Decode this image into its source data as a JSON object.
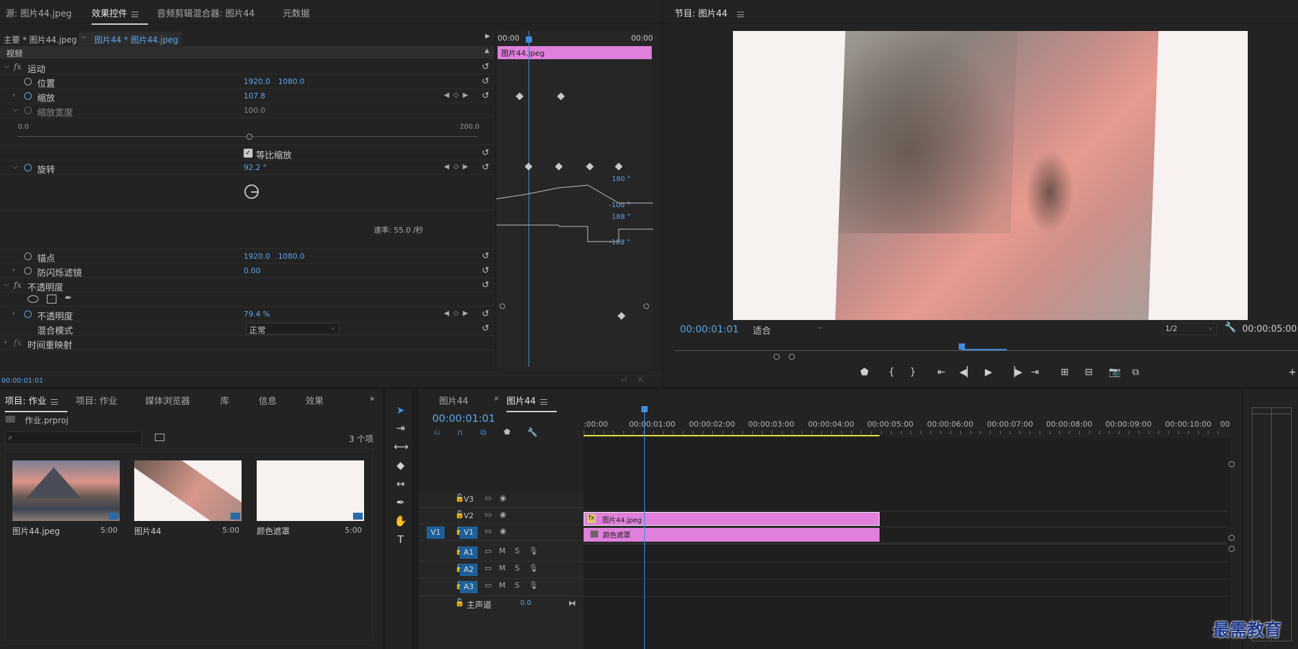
{
  "top_tabs": {
    "source": "源: 图片44.jpeg",
    "effect_controls": "效果控件",
    "audio_mixer": "音频剪辑混合器: 图片44",
    "metadata": "元数据",
    "program": "节目: 图片44"
  },
  "effect_controls": {
    "master_clip": "主要 * 图片44.jpeg",
    "active_clip": "图片44 * 图片44.jpeg",
    "section_video": "视频",
    "ruler_start": "00:00",
    "ruler_end": "00:00",
    "clip_bar_label": "图片44.jpeg",
    "motion": "运动",
    "position_label": "位置",
    "position_x": "1920.0",
    "position_y": "1080.0",
    "scale_label": "缩放",
    "scale_value": "107.8",
    "scale_width_label": "缩放宽度",
    "scale_width_value": "100.0",
    "slider_min": "0.0",
    "slider_max": "200.0",
    "uniform_scale": "等比缩放",
    "rotation_label": "旋转",
    "rotation_value": "92.2 °",
    "graph_top": "180 °",
    "graph_bottom": "-100 °",
    "velocity_top": "188 °",
    "velocity_bottom": "-188 °",
    "velocity_label": "速率: 55.0 /秒",
    "anchor_label": "锚点",
    "anchor_x": "1920.0",
    "anchor_y": "1080.0",
    "antiflicker_label": "防闪烁滤镜",
    "antiflicker_value": "0.00",
    "opacity_section": "不透明度",
    "opacity_label": "不透明度",
    "opacity_value": "79.4 %",
    "blend_label": "混合模式",
    "blend_value": "正常",
    "time_remap": "时间重映射",
    "current_time": "00:00:01:01"
  },
  "program_monitor": {
    "timecode": "00:00:01:01",
    "fit": "适合",
    "resolution": "1/2",
    "duration": "00:00:05:00"
  },
  "project_panel": {
    "tabs": [
      "项目: 作业",
      "项目: 作业",
      "媒体浏览器",
      "库",
      "信息",
      "效果"
    ],
    "project_file": "作业.prproj",
    "item_count": "3 个项",
    "items": [
      {
        "name": "图片44.jpeg",
        "duration": "5:00"
      },
      {
        "name": "图片44",
        "duration": "5:00"
      },
      {
        "name": "颜色遮罩",
        "duration": "5:00"
      }
    ]
  },
  "timeline": {
    "tab_inactive": "图片44",
    "tab_active": "图片44",
    "timecode": "00:00:01:01",
    "ruler": [
      ":00:00",
      "00:00:01:00",
      "00:00:02:00",
      "00:00:03:00",
      "00:00:04:00",
      "00:00:05:00",
      "00:00:06:00",
      "00:00:07:00",
      "00:00:08:00",
      "00:00:09:00",
      "00:00:10:00",
      "00"
    ],
    "tracks_video": [
      "V3",
      "V2",
      "V1"
    ],
    "tracks_audio": [
      "A1",
      "A2",
      "A3"
    ],
    "source_v1": "V1",
    "m": "M",
    "s": "S",
    "master": "主声道",
    "master_value": "0.0",
    "clip_v2": "图片44.jpeg",
    "clip_v1": "颜色遮罩",
    "clip_fx": "fx"
  },
  "watermark": "最需教育",
  "colors": {
    "accent_blue": "#5aa7ee",
    "clip_pink": "#e07fdc",
    "playhead": "#3d8ee0",
    "work_area": "#e8e03a"
  }
}
